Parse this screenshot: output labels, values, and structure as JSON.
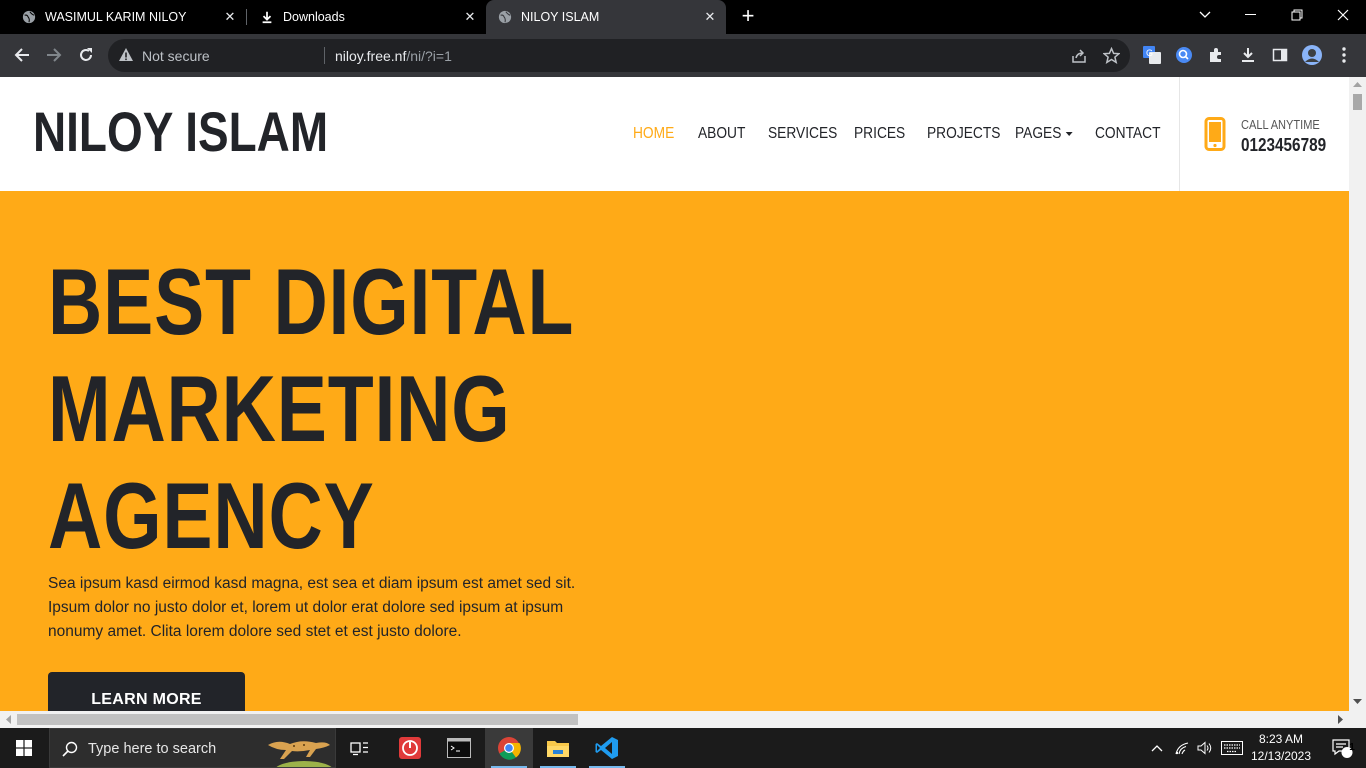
{
  "browser": {
    "tabs": [
      {
        "title": "WASIMUL KARIM NILOY",
        "icon": "globe-icon",
        "active": false
      },
      {
        "title": "Downloads",
        "icon": "download-icon",
        "active": false
      },
      {
        "title": "NILOY ISLAM",
        "icon": "globe-icon",
        "active": true
      }
    ],
    "security_label": "Not secure",
    "url_host": "niloy.free.nf",
    "url_path": "/ni/?i=1"
  },
  "site": {
    "logo": "NILOY ISLAM",
    "nav": [
      {
        "label": "HOME",
        "active": true
      },
      {
        "label": "ABOUT",
        "active": false
      },
      {
        "label": "SERVICES",
        "active": false
      },
      {
        "label": "PRICES",
        "active": false
      },
      {
        "label": "PROJECTS",
        "active": false
      },
      {
        "label": "PAGES",
        "active": false,
        "dropdown": true
      },
      {
        "label": "CONTACT",
        "active": false
      }
    ],
    "call_label": "CALL ANYTIME",
    "call_number": "0123456789",
    "hero": {
      "lines": [
        "BEST DIGITAL",
        "MARKETING",
        "AGENCY"
      ],
      "description": "Sea ipsum kasd eirmod kasd magna, est sea et diam ipsum est amet sed sit. Ipsum dolor no justo dolor et, lorem ut dolor erat dolore sed ipsum at ipsum nonumy amet. Clita lorem dolore sed stet et est justo dolore.",
      "button": "LEARN MORE"
    },
    "colors": {
      "accent": "#ffaa17",
      "dark": "#222429"
    }
  },
  "taskbar": {
    "search_placeholder": "Type here to search",
    "time": "8:23 AM",
    "date": "12/13/2023",
    "notification_count": "1"
  }
}
